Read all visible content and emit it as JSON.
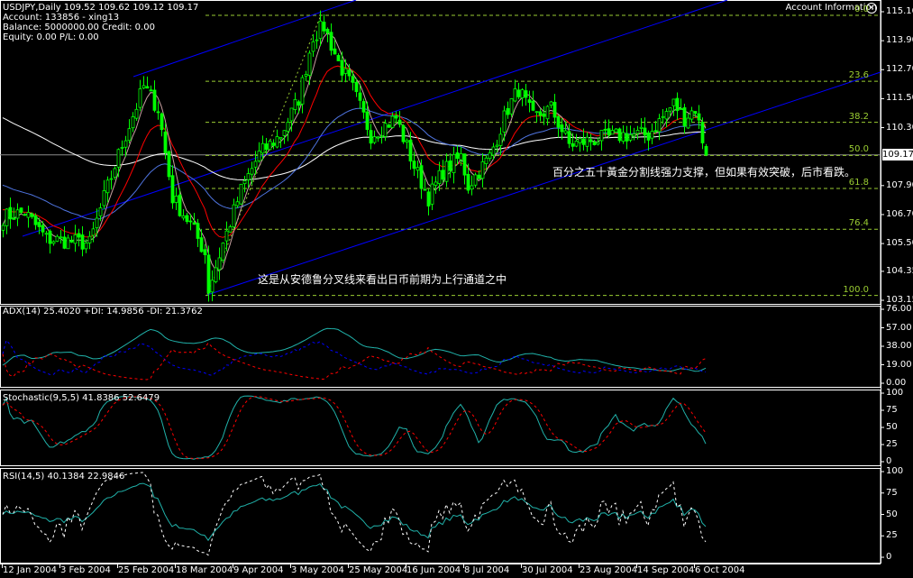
{
  "header": {
    "symbol_line": "USDJPY,Daily  109.52 109.62 109.12 109.17",
    "account": "Account: 133856 - xing13",
    "balance": "Balance: 5000000.00 Credit: 0.00",
    "equity": "Equity: 0.00 P/L: 0.00"
  },
  "account_info": {
    "label": "Account Information",
    "icon": "close-circle-icon",
    "icon_glyph": "✕"
  },
  "annotations": {
    "fib50_note": "百分之五十黃金分割线强力支撑，但如果有效突破，后市看跌。",
    "channel_note": "这是从安德鲁分叉线来看出日币前期为上行通道之中"
  },
  "colors": {
    "candle": "#00ff00",
    "fib": "#9acd32",
    "channel": "#0000ff",
    "ma_fast": "#c8a0a0",
    "ma_red": "#ff0000",
    "ma_blue": "#4f74e0",
    "ma_white": "#ffffff",
    "ind_main": "#20b2aa",
    "ind_red": "#ff0000",
    "ind_blue": "#0000ff",
    "rsi_fast": "#ffffff"
  },
  "chart_data": {
    "type": "candlestick",
    "symbol": "USDJPY",
    "timeframe": "Daily",
    "last_ohlc": {
      "open": 109.52,
      "high": 109.62,
      "low": 109.12,
      "close": 109.17
    },
    "current_price": "109.17",
    "price_ticks": [
      "115.10",
      "113.90",
      "112.70",
      "111.50",
      "110.30",
      "107.90",
      "106.70",
      "105.50",
      "104.35",
      "103.15"
    ],
    "price_tick_values": [
      115.1,
      113.9,
      112.7,
      111.5,
      110.3,
      107.9,
      106.7,
      105.5,
      104.35,
      103.15
    ],
    "fib_levels": [
      {
        "label": "0.0",
        "price": 114.95
      },
      {
        "label": "23.6",
        "price": 112.22
      },
      {
        "label": "38.2",
        "price": 110.52
      },
      {
        "label": "50.0",
        "price": 109.15
      },
      {
        "label": "61.8",
        "price": 107.78
      },
      {
        "label": "76.4",
        "price": 106.09
      },
      {
        "label": "100.0",
        "price": 103.35
      }
    ],
    "x_ticks": [
      "12 Jan 2004",
      "3 Feb 2004",
      "25 Feb 2004",
      "18 Mar 2004",
      "9 Apr 2004",
      "3 May 2004",
      "25 May 2004",
      "16 Jun 2004",
      "8 Jul 2004",
      "30 Jul 2004",
      "23 Aug 2004",
      "14 Sep 2004",
      "6 Oct 2004"
    ],
    "close_keypoints": [
      [
        0,
        106.6
      ],
      [
        6,
        106.8
      ],
      [
        12,
        105.7
      ],
      [
        24,
        105.5
      ],
      [
        28,
        107.4
      ],
      [
        33,
        109.6
      ],
      [
        39,
        112.0
      ],
      [
        43,
        111.1
      ],
      [
        47,
        107.4
      ],
      [
        52,
        106.3
      ],
      [
        56,
        105.1
      ],
      [
        57,
        103.6
      ],
      [
        61,
        105.5
      ],
      [
        66,
        107.7
      ],
      [
        71,
        109.2
      ],
      [
        77,
        110.0
      ],
      [
        82,
        111.5
      ],
      [
        86,
        114.1
      ],
      [
        89,
        114.5
      ],
      [
        93,
        113.0
      ],
      [
        97,
        111.9
      ],
      [
        102,
        110.0
      ],
      [
        109,
        110.7
      ],
      [
        114,
        108.7
      ],
      [
        118,
        107.4
      ],
      [
        122,
        108.5
      ],
      [
        127,
        109.1
      ],
      [
        129,
        107.9
      ],
      [
        135,
        109.1
      ],
      [
        140,
        111.1
      ],
      [
        143,
        111.9
      ],
      [
        147,
        110.7
      ],
      [
        152,
        111.1
      ],
      [
        157,
        109.6
      ],
      [
        164,
        109.8
      ],
      [
        172,
        110.0
      ],
      [
        179,
        110.0
      ],
      [
        186,
        111.3
      ],
      [
        189,
        110.7
      ],
      [
        192,
        111.1
      ],
      [
        195,
        109.17
      ]
    ],
    "indicators": {
      "adx": {
        "label": "ADX(14) 25.4020  +DI: 14.9856  -DI: 21.3762",
        "ticks": [
          "76.00",
          "57.00",
          "38.00",
          "19.00",
          "0.00"
        ],
        "tick_values": [
          76,
          57,
          38,
          19,
          0
        ],
        "range": [
          0,
          76
        ]
      },
      "stochastic": {
        "label": "Stochastic(9,5,5)  41.8386  52.6479",
        "ticks": [
          "100",
          "75",
          "50",
          "25",
          "0"
        ],
        "tick_values": [
          100,
          75,
          50,
          25,
          0
        ],
        "range": [
          0,
          100
        ]
      },
      "rsi": {
        "label": "RSI(14,5)  40.1384  22.9846",
        "ticks": [
          "100",
          "75",
          "50",
          "25",
          "0"
        ],
        "tick_values": [
          100,
          75,
          50,
          25,
          0
        ],
        "range": [
          0,
          100
        ]
      }
    }
  }
}
